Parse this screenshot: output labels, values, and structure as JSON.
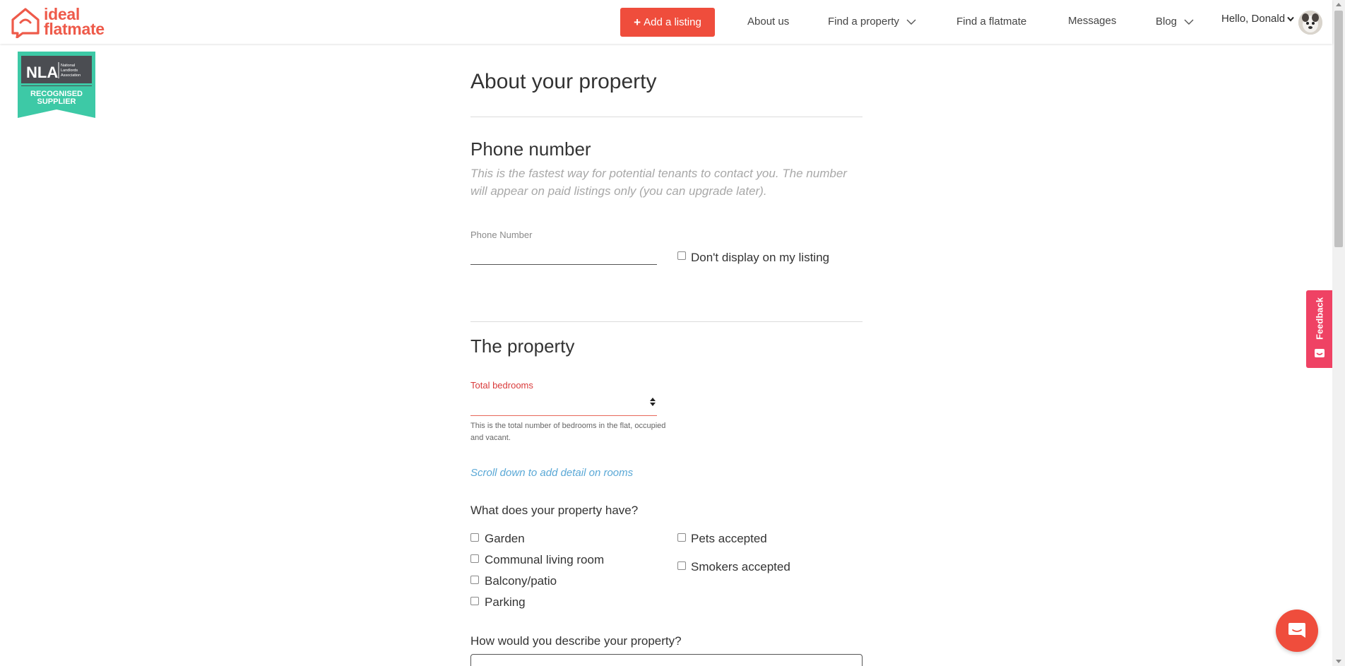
{
  "header": {
    "logo_line1": "ideal",
    "logo_line2": "flatmate",
    "add_listing_label": "Add a listing",
    "nav": {
      "about": "About us",
      "find_property": "Find a property",
      "find_flatmate": "Find a flatmate",
      "messages": "Messages",
      "blog": "Blog"
    },
    "greeting": "Hello, Donald"
  },
  "badge": {
    "nla": "NLA",
    "nla_small": "National Landlords Association",
    "line1": "RECOGNISED",
    "line2": "SUPPLIER"
  },
  "form": {
    "title": "About your property",
    "phone_section": {
      "heading": "Phone number",
      "intro": "This is the fastest way for potential tenants to contact you. The number will appear on paid listings only (you can upgrade later).",
      "field_label": "Phone Number",
      "field_value": "",
      "hide_label": "Don't display on my listing"
    },
    "property_section": {
      "heading": "The property",
      "bedrooms_label": "Total bedrooms",
      "bedrooms_value": "",
      "bedrooms_help": "This is the total number of bedrooms in the flat, occupied and vacant.",
      "scroll_hint": "Scroll down to add detail on rooms",
      "amenities_question": "What does your property have?",
      "amenities_left": [
        "Garden",
        "Communal living room",
        "Balcony/patio",
        "Parking"
      ],
      "amenities_right": [
        "Pets accepted",
        "Smokers accepted"
      ],
      "describe_question": "How would you describe your property?"
    }
  },
  "feedback_label": "Feedback",
  "colors": {
    "brand": "#ee5a4a",
    "add_button": "#ef4d3c",
    "feedback_tab": "#ef4264",
    "badge_teal": "#3dc9a6",
    "link_blue": "#5aa8d6",
    "error_red": "#d93a3a"
  }
}
